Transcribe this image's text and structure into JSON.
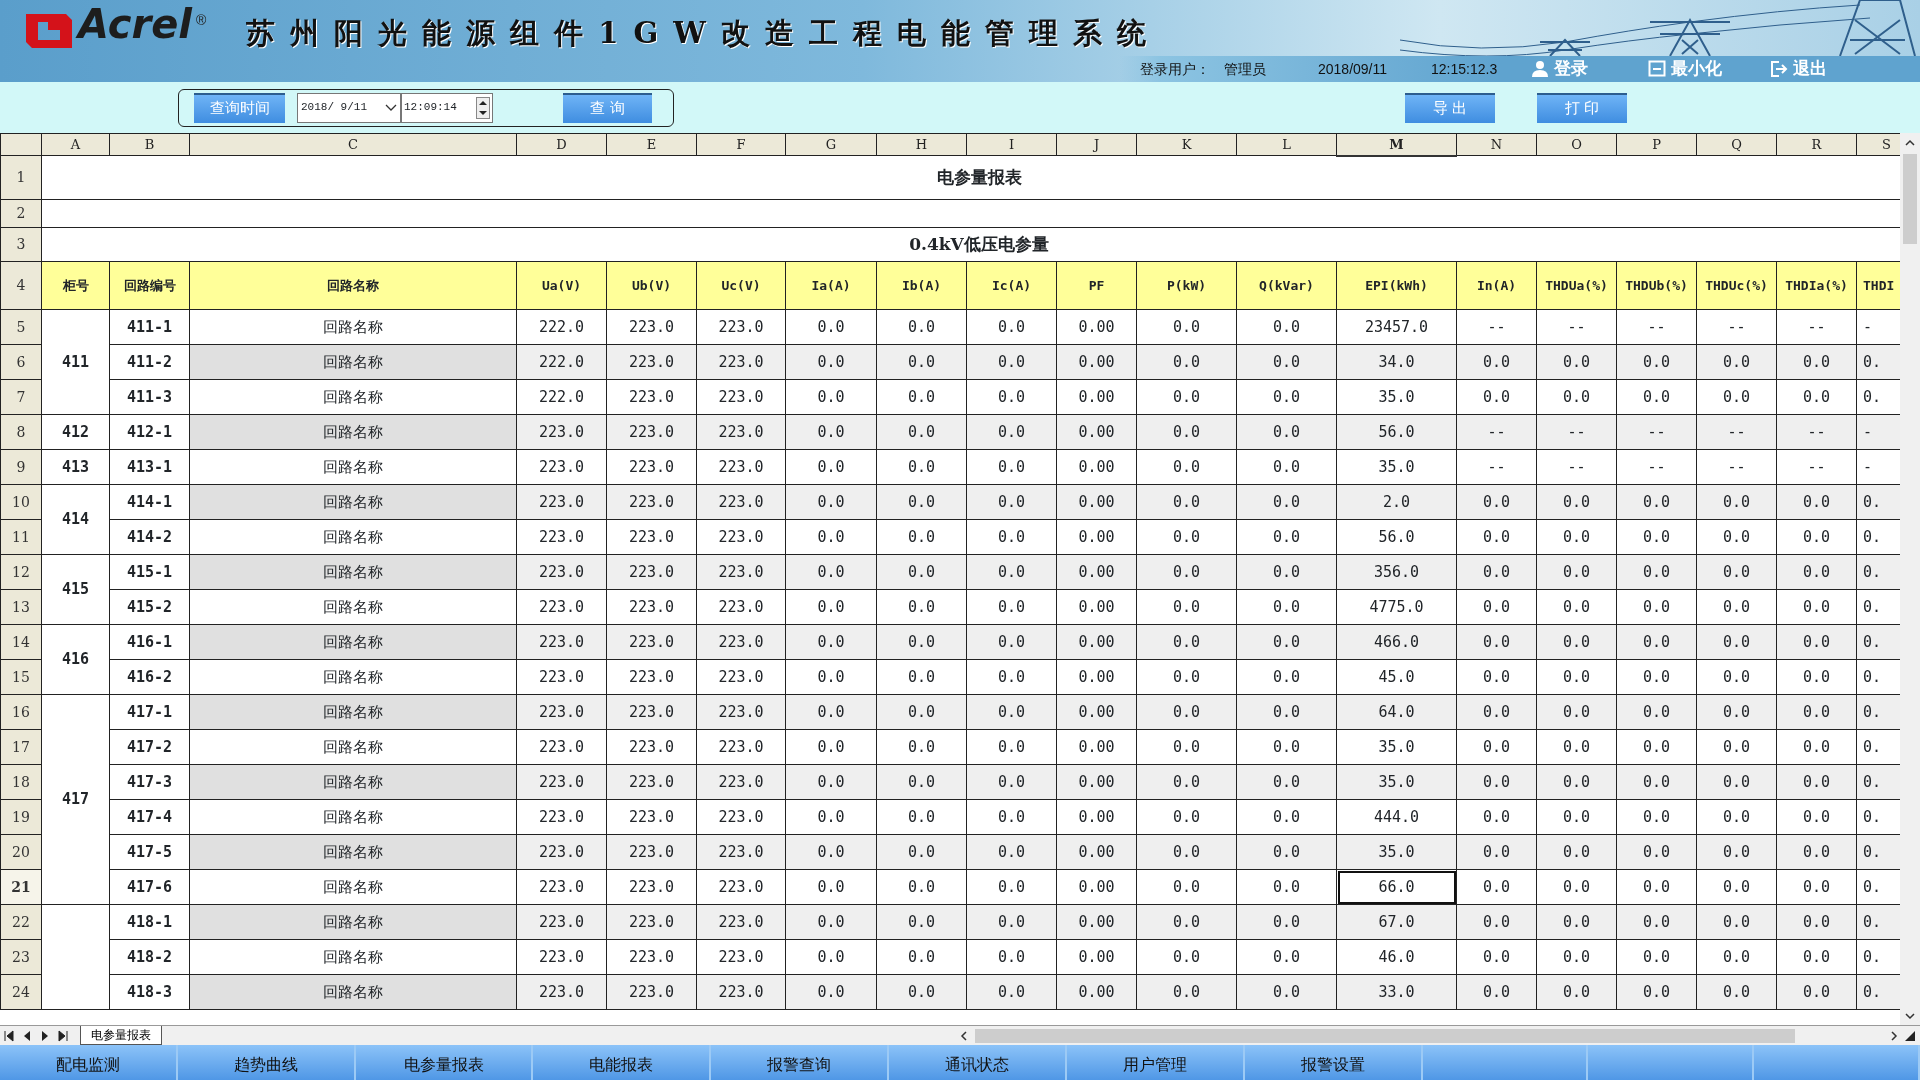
{
  "header": {
    "logo": "Acrel",
    "registered_mark": "®",
    "title": "苏州阳光能源组件1GW改造工程电能管理系统",
    "user_label": "登录用户：",
    "user_name": "管理员",
    "date": "2018/09/11",
    "time": "12:15:12.3",
    "actions": [
      {
        "kind": "login",
        "label": "登录"
      },
      {
        "kind": "minimize",
        "label": "最小化"
      },
      {
        "kind": "exit",
        "label": "退出"
      }
    ]
  },
  "query_bar": {
    "time_button": "查询时间",
    "date": "2018/ 9/11",
    "time": "12:09:14",
    "query_button": "查 询",
    "export_button": "导 出",
    "print_button": "打 印"
  },
  "sheet": {
    "column_letters": [
      {
        "label": "A",
        "selected": false
      },
      {
        "label": "B",
        "selected": false
      },
      {
        "label": "C",
        "selected": false
      },
      {
        "label": "D",
        "selected": false
      },
      {
        "label": "E",
        "selected": false
      },
      {
        "label": "F",
        "selected": false
      },
      {
        "label": "G",
        "selected": false
      },
      {
        "label": "H",
        "selected": false
      },
      {
        "label": "I",
        "selected": false
      },
      {
        "label": "J",
        "selected": false
      },
      {
        "label": "K",
        "selected": false
      },
      {
        "label": "L",
        "selected": false
      },
      {
        "label": "M",
        "selected": true
      },
      {
        "label": "N",
        "selected": false
      },
      {
        "label": "O",
        "selected": false
      },
      {
        "label": "P",
        "selected": false
      },
      {
        "label": "Q",
        "selected": false
      },
      {
        "label": "R",
        "selected": false
      },
      {
        "label": "S",
        "selected": false
      }
    ],
    "title": {
      "row": "1",
      "text": "电参量报表"
    },
    "blank_row": "2",
    "subtitle": {
      "row": "3",
      "text": "0.4kV低压电参量"
    },
    "header_row": "4",
    "columns": [
      "柜号",
      "回路编号",
      "回路名称",
      "Ua(V)",
      "Ub(V)",
      "Uc(V)",
      "Ia(A)",
      "Ib(A)",
      "Ic(A)",
      "PF",
      "P(kW)",
      "Q(kVar)",
      "EPI(kWh)",
      "In(A)",
      "THDUa(%)",
      "THDUb(%)",
      "THDUc(%)",
      "THDIa(%)",
      "THDI"
    ],
    "groups": [
      {
        "cabinet": "411",
        "rows": [
          {
            "row": "5",
            "circuit": "411-1",
            "name": "回路名称",
            "selected": false,
            "values": [
              "222.0",
              "223.0",
              "223.0",
              "0.0",
              "0.0",
              "0.0",
              "0.00",
              "0.0",
              "0.0",
              "23457.0",
              "--",
              "--",
              "--",
              "--",
              "--",
              "-"
            ]
          },
          {
            "row": "6",
            "circuit": "411-2",
            "name": "回路名称",
            "selected": false,
            "values": [
              "222.0",
              "223.0",
              "223.0",
              "0.0",
              "0.0",
              "0.0",
              "0.00",
              "0.0",
              "0.0",
              "34.0",
              "0.0",
              "0.0",
              "0.0",
              "0.0",
              "0.0",
              "0."
            ]
          },
          {
            "row": "7",
            "circuit": "411-3",
            "name": "回路名称",
            "selected": false,
            "values": [
              "222.0",
              "223.0",
              "223.0",
              "0.0",
              "0.0",
              "0.0",
              "0.00",
              "0.0",
              "0.0",
              "35.0",
              "0.0",
              "0.0",
              "0.0",
              "0.0",
              "0.0",
              "0."
            ]
          }
        ]
      },
      {
        "cabinet": "412",
        "rows": [
          {
            "row": "8",
            "circuit": "412-1",
            "name": "回路名称",
            "selected": false,
            "values": [
              "223.0",
              "223.0",
              "223.0",
              "0.0",
              "0.0",
              "0.0",
              "0.00",
              "0.0",
              "0.0",
              "56.0",
              "--",
              "--",
              "--",
              "--",
              "--",
              "-"
            ]
          }
        ]
      },
      {
        "cabinet": "413",
        "rows": [
          {
            "row": "9",
            "circuit": "413-1",
            "name": "回路名称",
            "selected": false,
            "values": [
              "223.0",
              "223.0",
              "223.0",
              "0.0",
              "0.0",
              "0.0",
              "0.00",
              "0.0",
              "0.0",
              "35.0",
              "--",
              "--",
              "--",
              "--",
              "--",
              "-"
            ]
          }
        ]
      },
      {
        "cabinet": "414",
        "rows": [
          {
            "row": "10",
            "circuit": "414-1",
            "name": "回路名称",
            "selected": false,
            "values": [
              "223.0",
              "223.0",
              "223.0",
              "0.0",
              "0.0",
              "0.0",
              "0.00",
              "0.0",
              "0.0",
              "2.0",
              "0.0",
              "0.0",
              "0.0",
              "0.0",
              "0.0",
              "0."
            ]
          },
          {
            "row": "11",
            "circuit": "414-2",
            "name": "回路名称",
            "selected": false,
            "values": [
              "223.0",
              "223.0",
              "223.0",
              "0.0",
              "0.0",
              "0.0",
              "0.00",
              "0.0",
              "0.0",
              "56.0",
              "0.0",
              "0.0",
              "0.0",
              "0.0",
              "0.0",
              "0."
            ]
          }
        ]
      },
      {
        "cabinet": "415",
        "rows": [
          {
            "row": "12",
            "circuit": "415-1",
            "name": "回路名称",
            "selected": false,
            "values": [
              "223.0",
              "223.0",
              "223.0",
              "0.0",
              "0.0",
              "0.0",
              "0.00",
              "0.0",
              "0.0",
              "356.0",
              "0.0",
              "0.0",
              "0.0",
              "0.0",
              "0.0",
              "0."
            ]
          },
          {
            "row": "13",
            "circuit": "415-2",
            "name": "回路名称",
            "selected": false,
            "values": [
              "223.0",
              "223.0",
              "223.0",
              "0.0",
              "0.0",
              "0.0",
              "0.00",
              "0.0",
              "0.0",
              "4775.0",
              "0.0",
              "0.0",
              "0.0",
              "0.0",
              "0.0",
              "0."
            ]
          }
        ]
      },
      {
        "cabinet": "416",
        "rows": [
          {
            "row": "14",
            "circuit": "416-1",
            "name": "回路名称",
            "selected": false,
            "values": [
              "223.0",
              "223.0",
              "223.0",
              "0.0",
              "0.0",
              "0.0",
              "0.00",
              "0.0",
              "0.0",
              "466.0",
              "0.0",
              "0.0",
              "0.0",
              "0.0",
              "0.0",
              "0."
            ]
          },
          {
            "row": "15",
            "circuit": "416-2",
            "name": "回路名称",
            "selected": false,
            "values": [
              "223.0",
              "223.0",
              "223.0",
              "0.0",
              "0.0",
              "0.0",
              "0.00",
              "0.0",
              "0.0",
              "45.0",
              "0.0",
              "0.0",
              "0.0",
              "0.0",
              "0.0",
              "0."
            ]
          }
        ]
      },
      {
        "cabinet": "417",
        "rows": [
          {
            "row": "16",
            "circuit": "417-1",
            "name": "回路名称",
            "selected": false,
            "values": [
              "223.0",
              "223.0",
              "223.0",
              "0.0",
              "0.0",
              "0.0",
              "0.00",
              "0.0",
              "0.0",
              "64.0",
              "0.0",
              "0.0",
              "0.0",
              "0.0",
              "0.0",
              "0."
            ]
          },
          {
            "row": "17",
            "circuit": "417-2",
            "name": "回路名称",
            "selected": false,
            "values": [
              "223.0",
              "223.0",
              "223.0",
              "0.0",
              "0.0",
              "0.0",
              "0.00",
              "0.0",
              "0.0",
              "35.0",
              "0.0",
              "0.0",
              "0.0",
              "0.0",
              "0.0",
              "0."
            ]
          },
          {
            "row": "18",
            "circuit": "417-3",
            "name": "回路名称",
            "selected": false,
            "values": [
              "223.0",
              "223.0",
              "223.0",
              "0.0",
              "0.0",
              "0.0",
              "0.00",
              "0.0",
              "0.0",
              "35.0",
              "0.0",
              "0.0",
              "0.0",
              "0.0",
              "0.0",
              "0."
            ]
          },
          {
            "row": "19",
            "circuit": "417-4",
            "name": "回路名称",
            "selected": false,
            "values": [
              "223.0",
              "223.0",
              "223.0",
              "0.0",
              "0.0",
              "0.0",
              "0.00",
              "0.0",
              "0.0",
              "444.0",
              "0.0",
              "0.0",
              "0.0",
              "0.0",
              "0.0",
              "0."
            ]
          },
          {
            "row": "20",
            "circuit": "417-5",
            "name": "回路名称",
            "selected": false,
            "values": [
              "223.0",
              "223.0",
              "223.0",
              "0.0",
              "0.0",
              "0.0",
              "0.00",
              "0.0",
              "0.0",
              "35.0",
              "0.0",
              "0.0",
              "0.0",
              "0.0",
              "0.0",
              "0."
            ]
          },
          {
            "row": "21",
            "circuit": "417-6",
            "name": "回路名称",
            "selected": true,
            "values": [
              "223.0",
              "223.0",
              "223.0",
              "0.0",
              "0.0",
              "0.0",
              "0.00",
              "0.0",
              "0.0",
              "66.0",
              "0.0",
              "0.0",
              "0.0",
              "0.0",
              "0.0",
              "0."
            ]
          }
        ]
      },
      {
        "rows": [
          {
            "row": "22",
            "circuit": "418-1",
            "name": "回路名称",
            "selected": false,
            "values": [
              "223.0",
              "223.0",
              "223.0",
              "0.0",
              "0.0",
              "0.0",
              "0.00",
              "0.0",
              "0.0",
              "67.0",
              "0.0",
              "0.0",
              "0.0",
              "0.0",
              "0.0",
              "0."
            ]
          },
          {
            "row": "23",
            "circuit": "418-2",
            "name": "回路名称",
            "selected": false,
            "values": [
              "223.0",
              "223.0",
              "223.0",
              "0.0",
              "0.0",
              "0.0",
              "0.00",
              "0.0",
              "0.0",
              "46.0",
              "0.0",
              "0.0",
              "0.0",
              "0.0",
              "0.0",
              "0."
            ]
          },
          {
            "row": "24",
            "circuit": "418-3",
            "name": "回路名称",
            "selected": false,
            "values": [
              "223.0",
              "223.0",
              "223.0",
              "0.0",
              "0.0",
              "0.0",
              "0.00",
              "0.0",
              "0.0",
              "33.0",
              "0.0",
              "0.0",
              "0.0",
              "0.0",
              "0.0",
              "0."
            ]
          }
        ]
      }
    ]
  },
  "sheet_tabs": [
    {
      "label": "电参量报表",
      "selected": true
    }
  ],
  "nav": [
    {
      "label": "配电监测"
    },
    {
      "label": "趋势曲线"
    },
    {
      "label": "电参量报表"
    },
    {
      "label": "电能报表"
    },
    {
      "label": "报警查询"
    },
    {
      "label": "通讯状态"
    },
    {
      "label": "用户管理"
    },
    {
      "label": "报警设置"
    }
  ]
}
